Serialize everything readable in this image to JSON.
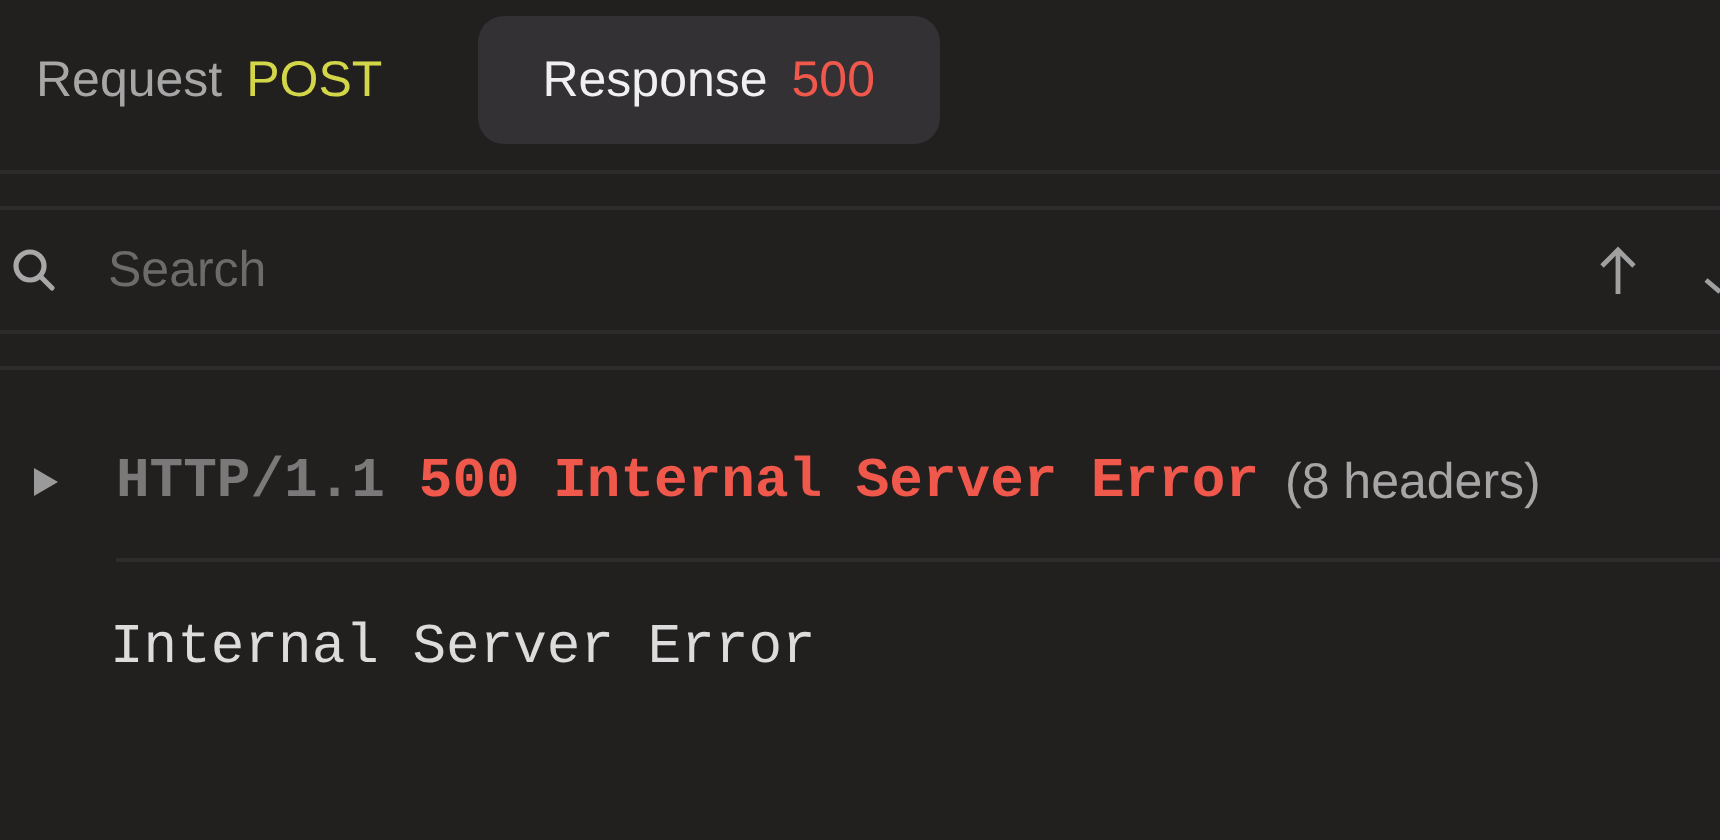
{
  "tabs": [
    {
      "label": "Request",
      "badge": "POST",
      "color": "#d4d64a",
      "selected": false
    },
    {
      "label": "Response",
      "badge": "500",
      "color": "#f0584c",
      "selected": true
    }
  ],
  "search": {
    "placeholder": "Search"
  },
  "status": {
    "protocol": "HTTP/1.1",
    "code": "500 Internal Server Error",
    "headers": "(8 headers)",
    "expanded": false
  },
  "body": "Internal Server Error"
}
